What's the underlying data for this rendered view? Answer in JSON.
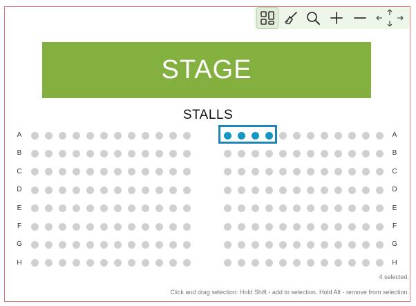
{
  "stage_label": "STAGE",
  "section_label": "STALLS",
  "rows": [
    "A",
    "B",
    "C",
    "D",
    "E",
    "F",
    "G",
    "H"
  ],
  "seats_per_block": 12,
  "selected_seats": [
    {
      "row": "A",
      "block": "right",
      "seat": 1
    },
    {
      "row": "A",
      "block": "right",
      "seat": 2
    },
    {
      "row": "A",
      "block": "right",
      "seat": 3
    },
    {
      "row": "A",
      "block": "right",
      "seat": 4
    }
  ],
  "status_text": "4 selected.",
  "hint_text": "Click and drag selection: Hold Shift - add to selection. Hold Alt - remove from selection.",
  "toolbar": {
    "buttons": [
      "select-mode-icon",
      "brush-icon",
      "search-icon",
      "zoom-in-icon",
      "zoom-out-icon",
      "pan-icon"
    ],
    "active": "select-mode-icon"
  },
  "colors": {
    "stage": "#84b040",
    "seat_available": "#d0d0d0",
    "seat_selected": "#1596c3",
    "selection_box": "#1e86b5",
    "toolbar_bg": "#eef5e9"
  }
}
